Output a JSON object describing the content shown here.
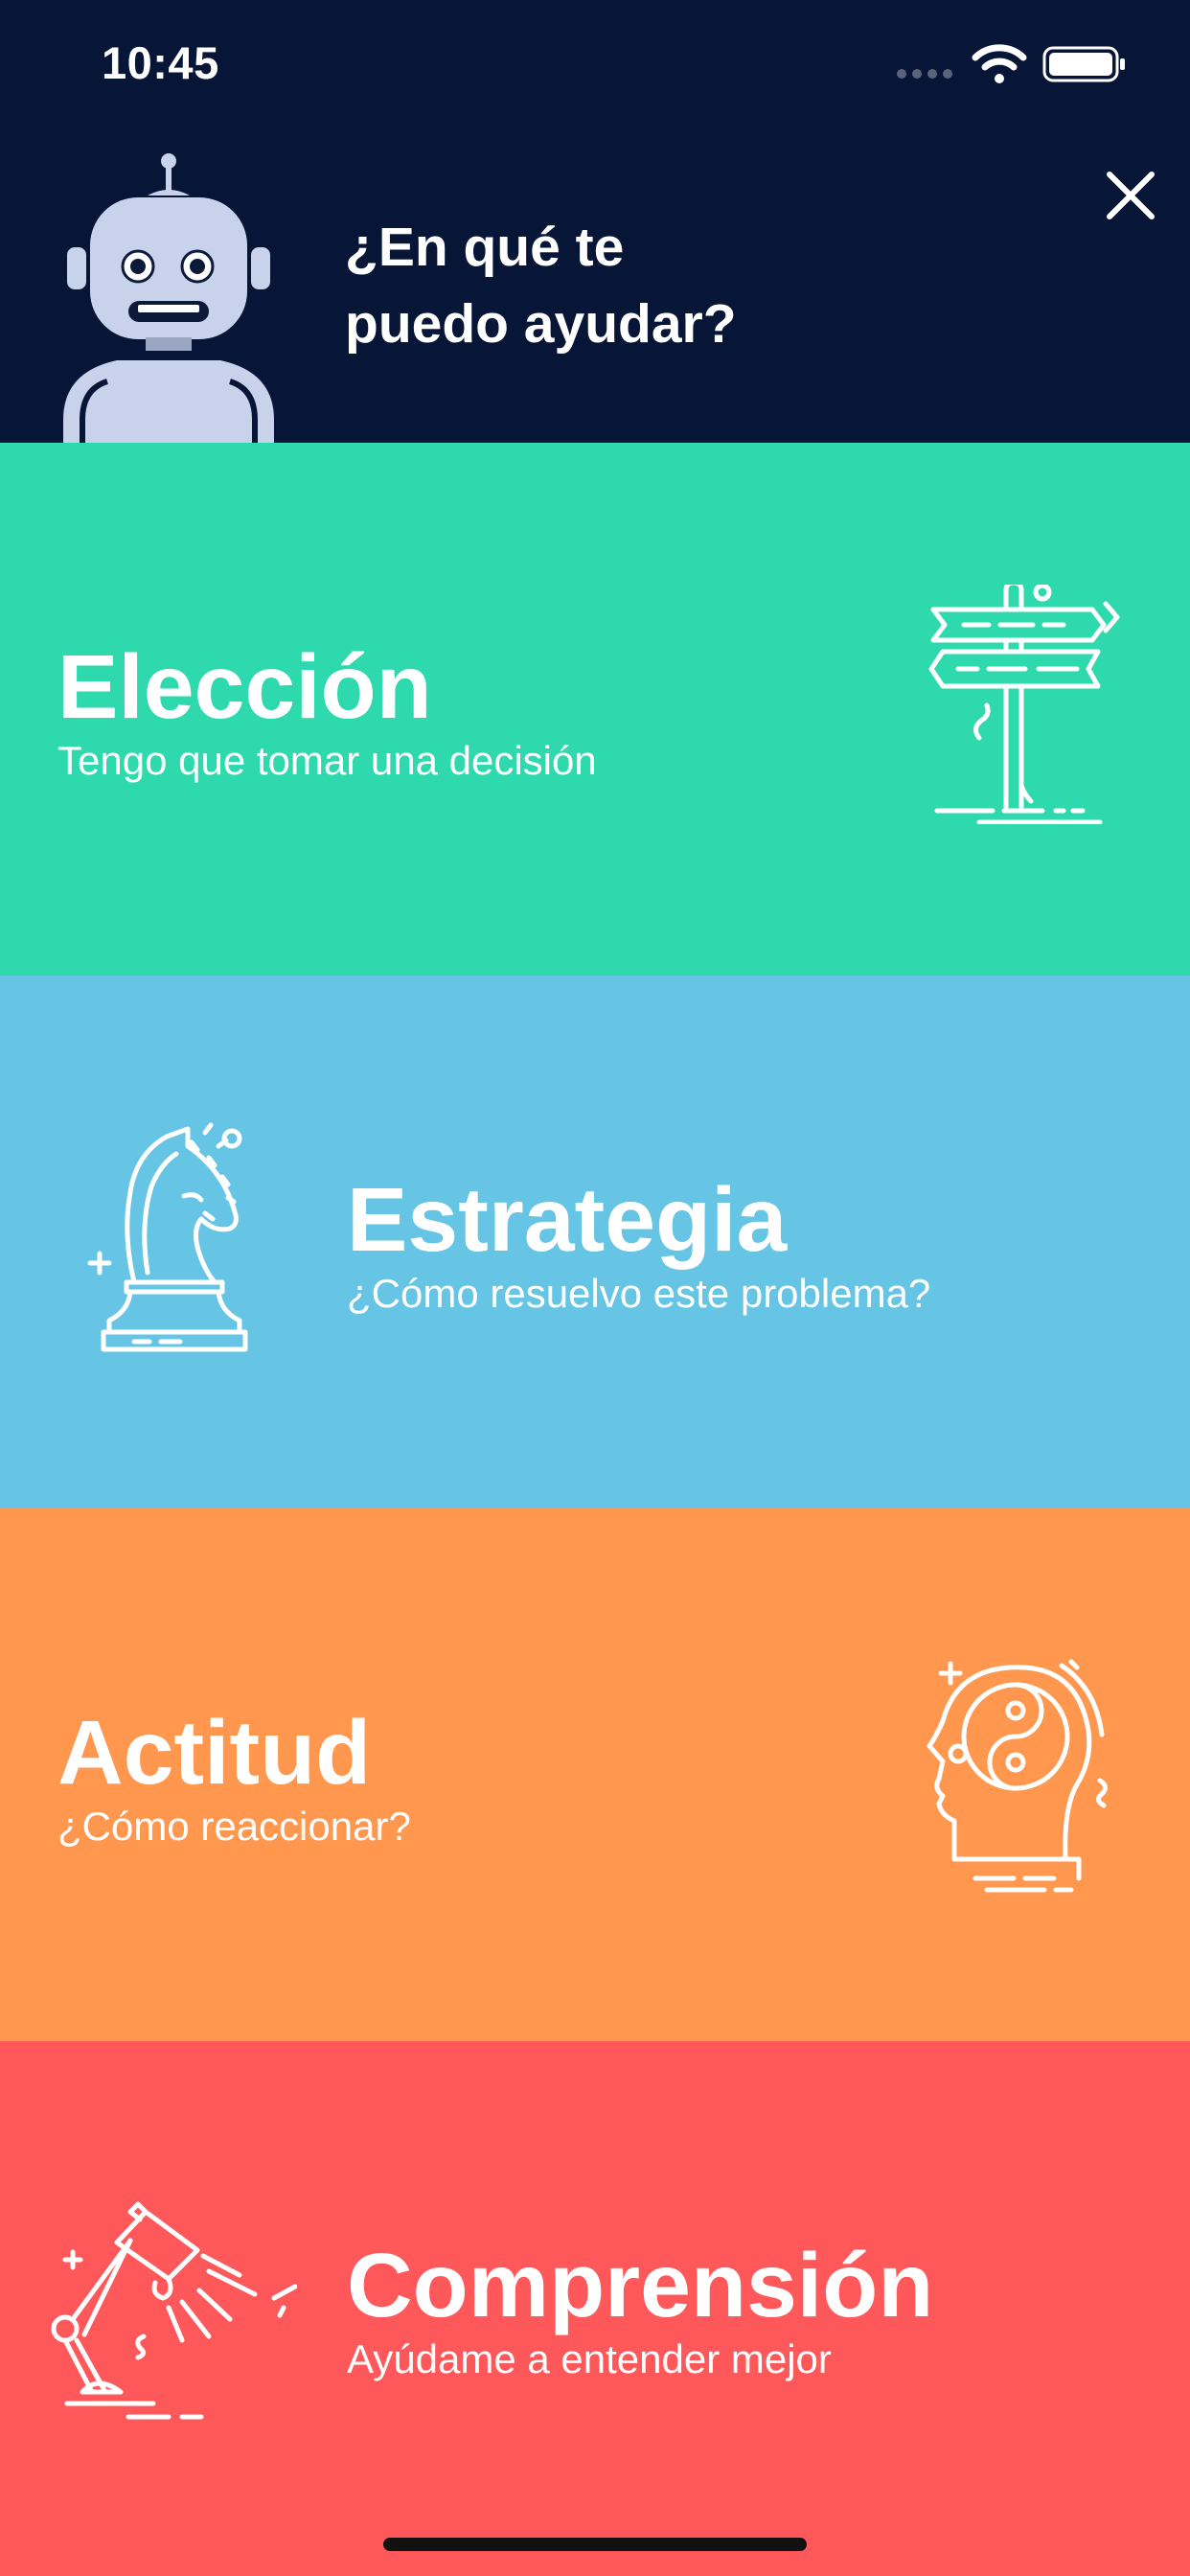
{
  "status_bar": {
    "time": "10:45"
  },
  "header": {
    "question_line1": "¿En qué te",
    "question_line2": "puedo ayudar?",
    "close_icon": "close-icon",
    "mascot_icon": "robot-avatar-icon"
  },
  "cards": [
    {
      "title": "Elección",
      "subtitle": "Tengo que tomar una decisión",
      "icon": "signpost-icon",
      "color": "#2EDAAD"
    },
    {
      "title": "Estrategia",
      "subtitle": "¿Cómo resuelvo este problema?",
      "icon": "chess-knight-icon",
      "color": "#66C4E4"
    },
    {
      "title": "Actitud",
      "subtitle": "¿Cómo reaccionar?",
      "icon": "yin-yang-head-icon",
      "color": "#FF974F"
    },
    {
      "title": "Comprensión",
      "subtitle": "Ayúdame a entender mejor",
      "icon": "desk-lamp-icon",
      "color": "#FF585A"
    }
  ],
  "colors": {
    "header_background": "#071537",
    "text": "#FFFFFF",
    "robot_body": "#C8D2EA"
  }
}
